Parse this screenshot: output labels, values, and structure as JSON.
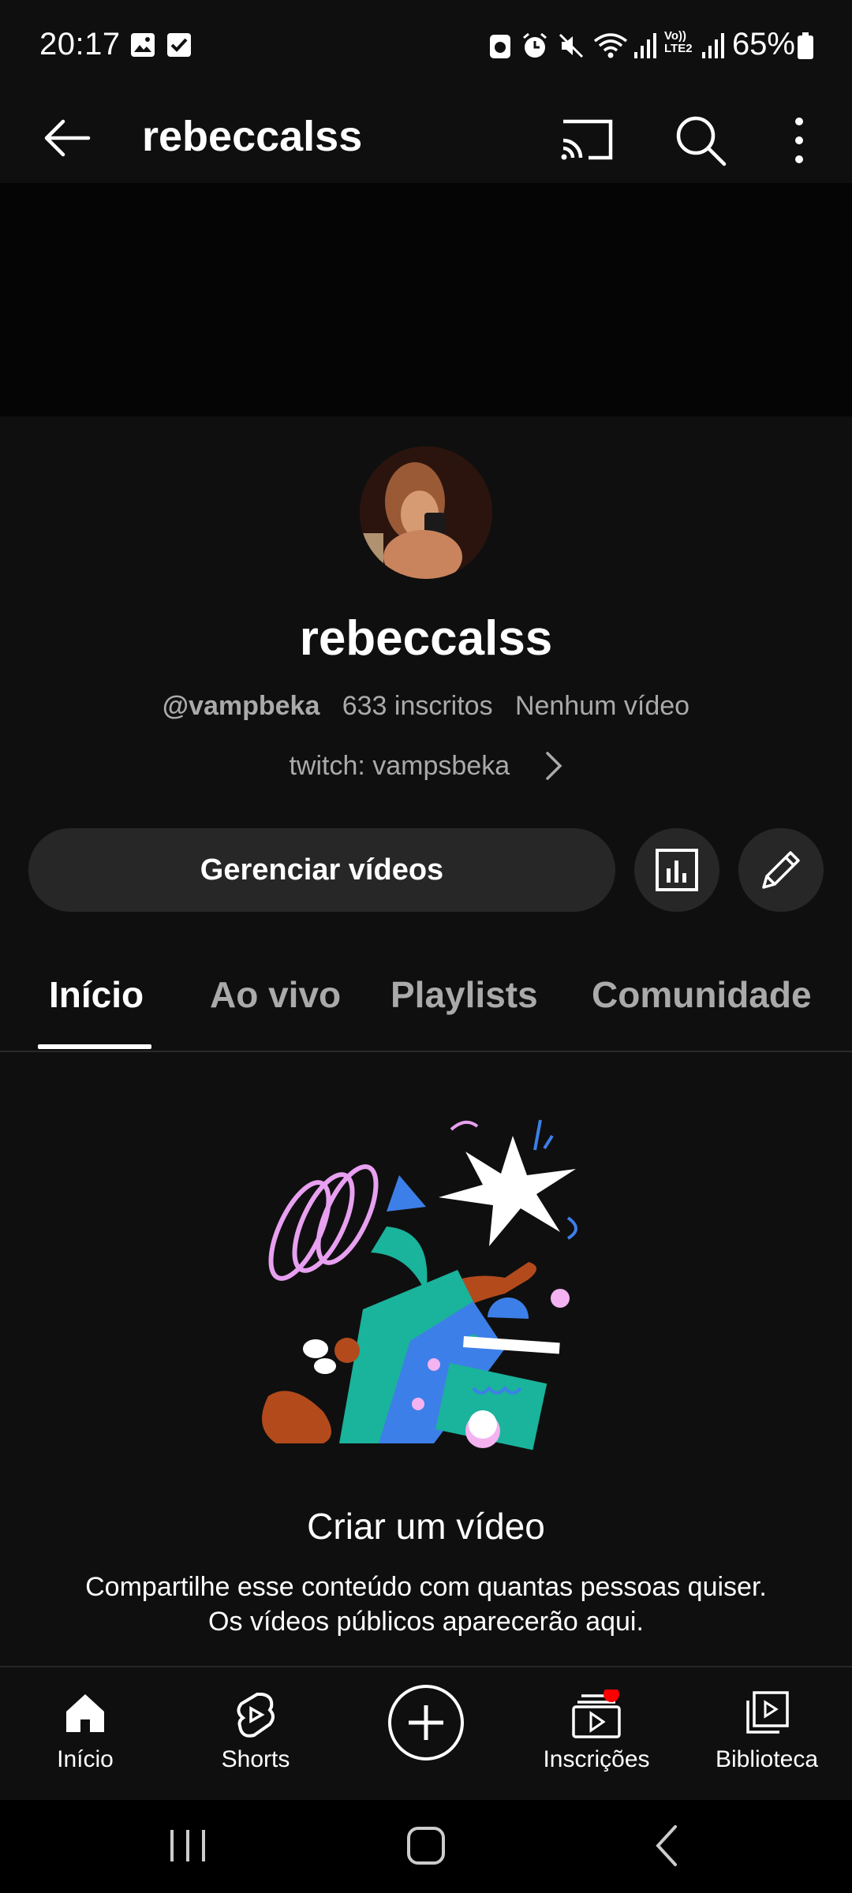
{
  "status_bar": {
    "time": "20:17",
    "battery": "65%",
    "icons": [
      "image-icon",
      "check-icon",
      "save-icon",
      "alarm-icon",
      "mute-icon",
      "wifi-icon",
      "signal-icon",
      "volte-icon",
      "signal-icon",
      "battery-icon"
    ]
  },
  "app_bar": {
    "title": "rebeccalss",
    "icons": [
      "back-arrow-icon",
      "cast-icon",
      "search-icon",
      "more-vert-icon"
    ]
  },
  "channel": {
    "name": "rebeccalss",
    "handle": "@vampbeka",
    "subscribers": "633 inscritos",
    "videos": "Nenhum vídeo",
    "link": "twitch: vampsbeka"
  },
  "actions": {
    "manage_label": "Gerenciar vídeos"
  },
  "tabs": [
    {
      "label": "Início",
      "active": true
    },
    {
      "label": "Ao vivo",
      "active": false
    },
    {
      "label": "Playlists",
      "active": false
    },
    {
      "label": "Comunidade",
      "active": false
    }
  ],
  "empty_state": {
    "title": "Criar um vídeo",
    "line1": "Compartilhe esse conteúdo com quantas pessoas quiser.",
    "line2": "Os vídeos públicos aparecerão aqui."
  },
  "bottom_nav": [
    {
      "label": "Início",
      "icon": "home-icon"
    },
    {
      "label": "Shorts",
      "icon": "shorts-icon"
    },
    {
      "label": "",
      "icon": "create-icon"
    },
    {
      "label": "Inscrições",
      "icon": "subscriptions-icon",
      "badge": true
    },
    {
      "label": "Biblioteca",
      "icon": "library-icon"
    }
  ],
  "colors": {
    "background": "#0f0f0f",
    "chip": "#272727",
    "badge": "#ff0000",
    "secondary_text": "#aaaaaa"
  }
}
